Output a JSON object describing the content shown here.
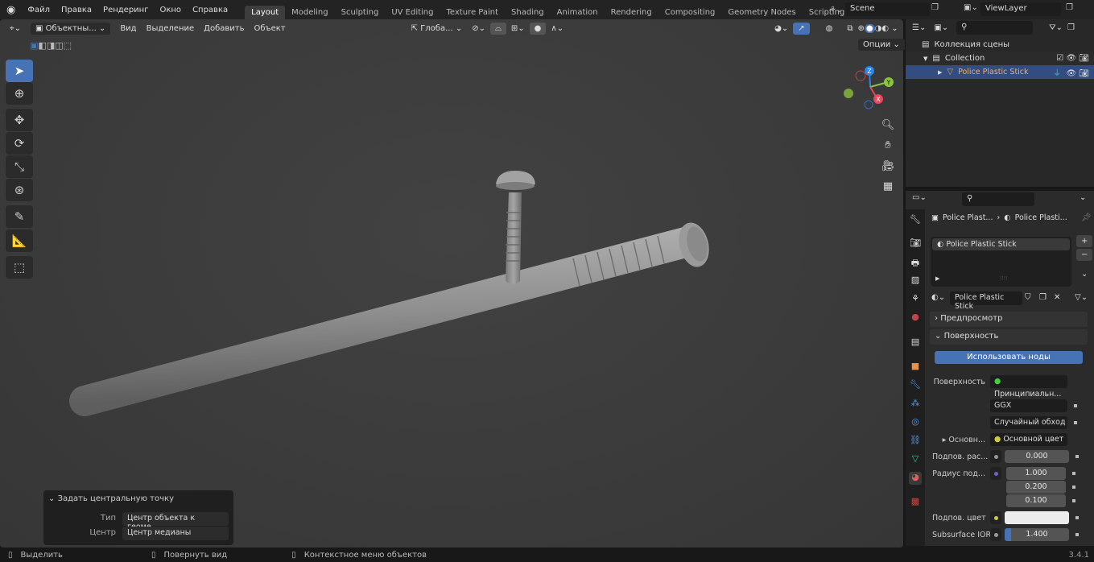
{
  "menu": [
    "Файл",
    "Правка",
    "Рендеринг",
    "Окно",
    "Справка"
  ],
  "workspaces": [
    "Layout",
    "Modeling",
    "Sculpting",
    "UV Editing",
    "Texture Paint",
    "Shading",
    "Animation",
    "Rendering",
    "Compositing",
    "Geometry Nodes",
    "Scripting"
  ],
  "scene": "Scene",
  "view_layer": "ViewLayer",
  "viewport_header": {
    "mode": "Объектны...",
    "menus": [
      "Вид",
      "Выделение",
      "Добавить",
      "Объект"
    ],
    "orientation": "Глоба...",
    "options": "Опции"
  },
  "gizmo": {
    "x": "X",
    "y": "Y",
    "z": "Z"
  },
  "last_op": {
    "title": "Задать центральную точку",
    "type_label": "Тип",
    "type_value": "Центр объекта к геоме...",
    "center_label": "Центр",
    "center_value": "Центр медианы"
  },
  "status": {
    "select": "Выделить",
    "rotate": "Повернуть вид",
    "context": "Контекстное меню объектов",
    "version": "3.4.1"
  },
  "outliner": {
    "scene_collection": "Коллекция сцены",
    "collection": "Collection",
    "object": "Police Plastic Stick"
  },
  "properties": {
    "breadcrumb_object": "Police Plast...",
    "breadcrumb_material": "Police Plasti...",
    "slot": "Police Plastic Stick",
    "material_name": "Police Plastic Stick",
    "preview": "Предпросмотр",
    "surface_panel": "Поверхность",
    "use_nodes": "Использовать ноды",
    "rows": {
      "surface_label": "Поверхность",
      "surface_value": "Принципиальн...",
      "distribution": "GGX",
      "subsurface_method": "Случайный обход",
      "base_label": "Основн...",
      "base_value": "Основной цвет",
      "ss_label": "Подпов. рас...",
      "ss_value": "0.000",
      "radius_label": "Радиус под...",
      "radius": [
        "1.000",
        "0.200",
        "0.100"
      ],
      "ss_color_label": "Подпов. цвет",
      "ior_label": "Subsurface IOR",
      "ior_value": "1.400"
    },
    "ior_fill": 0.1
  }
}
